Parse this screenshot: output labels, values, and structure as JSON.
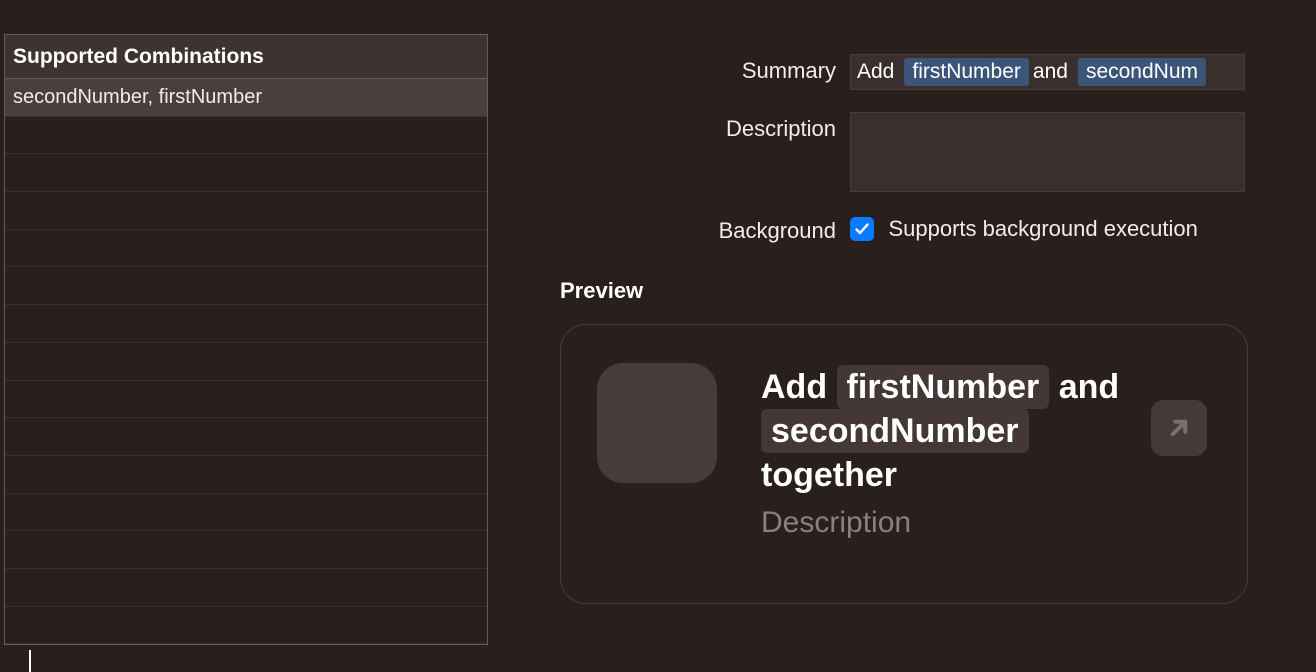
{
  "table": {
    "header": "Supported Combinations",
    "rows": [
      {
        "label": "secondNumber, firstNumber",
        "selected": true
      }
    ],
    "empty_rows": 14
  },
  "form": {
    "summary_label": "Summary",
    "summary": {
      "prefix": "Add",
      "token1": "firstNumber",
      "mid": "and",
      "token2": "secondNum"
    },
    "description_label": "Description",
    "description_value": "",
    "background_label": "Background",
    "background_checkbox_label": "Supports background execution",
    "background_checked": true
  },
  "preview": {
    "heading": "Preview",
    "title_prefix": "Add",
    "title_token1": "firstNumber",
    "title_mid": "and",
    "title_token2": "secondNumber",
    "title_suffix": "together",
    "description": "Description"
  }
}
